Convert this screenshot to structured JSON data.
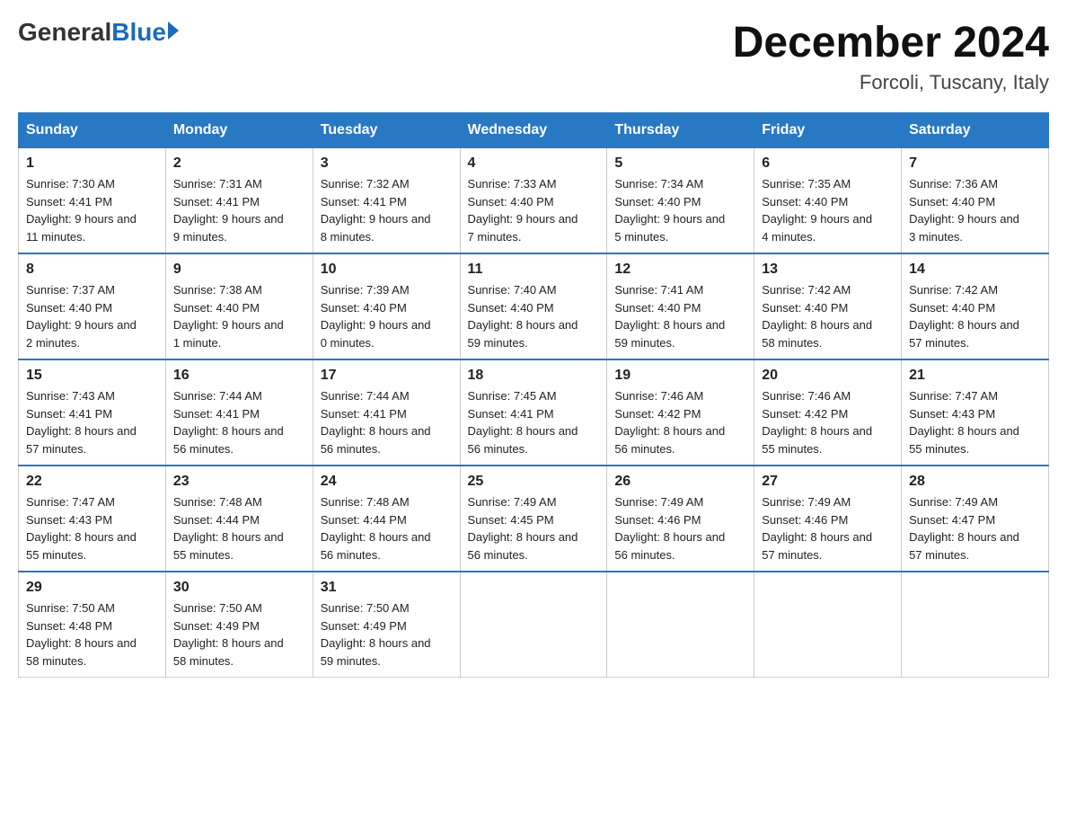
{
  "header": {
    "logo_general": "General",
    "logo_blue": "Blue",
    "month_title": "December 2024",
    "location": "Forcoli, Tuscany, Italy"
  },
  "weekdays": [
    "Sunday",
    "Monday",
    "Tuesday",
    "Wednesday",
    "Thursday",
    "Friday",
    "Saturday"
  ],
  "weeks": [
    [
      {
        "day": "1",
        "sunrise": "7:30 AM",
        "sunset": "4:41 PM",
        "daylight": "9 hours and 11 minutes."
      },
      {
        "day": "2",
        "sunrise": "7:31 AM",
        "sunset": "4:41 PM",
        "daylight": "9 hours and 9 minutes."
      },
      {
        "day": "3",
        "sunrise": "7:32 AM",
        "sunset": "4:41 PM",
        "daylight": "9 hours and 8 minutes."
      },
      {
        "day": "4",
        "sunrise": "7:33 AM",
        "sunset": "4:40 PM",
        "daylight": "9 hours and 7 minutes."
      },
      {
        "day": "5",
        "sunrise": "7:34 AM",
        "sunset": "4:40 PM",
        "daylight": "9 hours and 5 minutes."
      },
      {
        "day": "6",
        "sunrise": "7:35 AM",
        "sunset": "4:40 PM",
        "daylight": "9 hours and 4 minutes."
      },
      {
        "day": "7",
        "sunrise": "7:36 AM",
        "sunset": "4:40 PM",
        "daylight": "9 hours and 3 minutes."
      }
    ],
    [
      {
        "day": "8",
        "sunrise": "7:37 AM",
        "sunset": "4:40 PM",
        "daylight": "9 hours and 2 minutes."
      },
      {
        "day": "9",
        "sunrise": "7:38 AM",
        "sunset": "4:40 PM",
        "daylight": "9 hours and 1 minute."
      },
      {
        "day": "10",
        "sunrise": "7:39 AM",
        "sunset": "4:40 PM",
        "daylight": "9 hours and 0 minutes."
      },
      {
        "day": "11",
        "sunrise": "7:40 AM",
        "sunset": "4:40 PM",
        "daylight": "8 hours and 59 minutes."
      },
      {
        "day": "12",
        "sunrise": "7:41 AM",
        "sunset": "4:40 PM",
        "daylight": "8 hours and 59 minutes."
      },
      {
        "day": "13",
        "sunrise": "7:42 AM",
        "sunset": "4:40 PM",
        "daylight": "8 hours and 58 minutes."
      },
      {
        "day": "14",
        "sunrise": "7:42 AM",
        "sunset": "4:40 PM",
        "daylight": "8 hours and 57 minutes."
      }
    ],
    [
      {
        "day": "15",
        "sunrise": "7:43 AM",
        "sunset": "4:41 PM",
        "daylight": "8 hours and 57 minutes."
      },
      {
        "day": "16",
        "sunrise": "7:44 AM",
        "sunset": "4:41 PM",
        "daylight": "8 hours and 56 minutes."
      },
      {
        "day": "17",
        "sunrise": "7:44 AM",
        "sunset": "4:41 PM",
        "daylight": "8 hours and 56 minutes."
      },
      {
        "day": "18",
        "sunrise": "7:45 AM",
        "sunset": "4:41 PM",
        "daylight": "8 hours and 56 minutes."
      },
      {
        "day": "19",
        "sunrise": "7:46 AM",
        "sunset": "4:42 PM",
        "daylight": "8 hours and 56 minutes."
      },
      {
        "day": "20",
        "sunrise": "7:46 AM",
        "sunset": "4:42 PM",
        "daylight": "8 hours and 55 minutes."
      },
      {
        "day": "21",
        "sunrise": "7:47 AM",
        "sunset": "4:43 PM",
        "daylight": "8 hours and 55 minutes."
      }
    ],
    [
      {
        "day": "22",
        "sunrise": "7:47 AM",
        "sunset": "4:43 PM",
        "daylight": "8 hours and 55 minutes."
      },
      {
        "day": "23",
        "sunrise": "7:48 AM",
        "sunset": "4:44 PM",
        "daylight": "8 hours and 55 minutes."
      },
      {
        "day": "24",
        "sunrise": "7:48 AM",
        "sunset": "4:44 PM",
        "daylight": "8 hours and 56 minutes."
      },
      {
        "day": "25",
        "sunrise": "7:49 AM",
        "sunset": "4:45 PM",
        "daylight": "8 hours and 56 minutes."
      },
      {
        "day": "26",
        "sunrise": "7:49 AM",
        "sunset": "4:46 PM",
        "daylight": "8 hours and 56 minutes."
      },
      {
        "day": "27",
        "sunrise": "7:49 AM",
        "sunset": "4:46 PM",
        "daylight": "8 hours and 57 minutes."
      },
      {
        "day": "28",
        "sunrise": "7:49 AM",
        "sunset": "4:47 PM",
        "daylight": "8 hours and 57 minutes."
      }
    ],
    [
      {
        "day": "29",
        "sunrise": "7:50 AM",
        "sunset": "4:48 PM",
        "daylight": "8 hours and 58 minutes."
      },
      {
        "day": "30",
        "sunrise": "7:50 AM",
        "sunset": "4:49 PM",
        "daylight": "8 hours and 58 minutes."
      },
      {
        "day": "31",
        "sunrise": "7:50 AM",
        "sunset": "4:49 PM",
        "daylight": "8 hours and 59 minutes."
      },
      null,
      null,
      null,
      null
    ]
  ],
  "labels": {
    "sunrise": "Sunrise:",
    "sunset": "Sunset:",
    "daylight": "Daylight:"
  }
}
